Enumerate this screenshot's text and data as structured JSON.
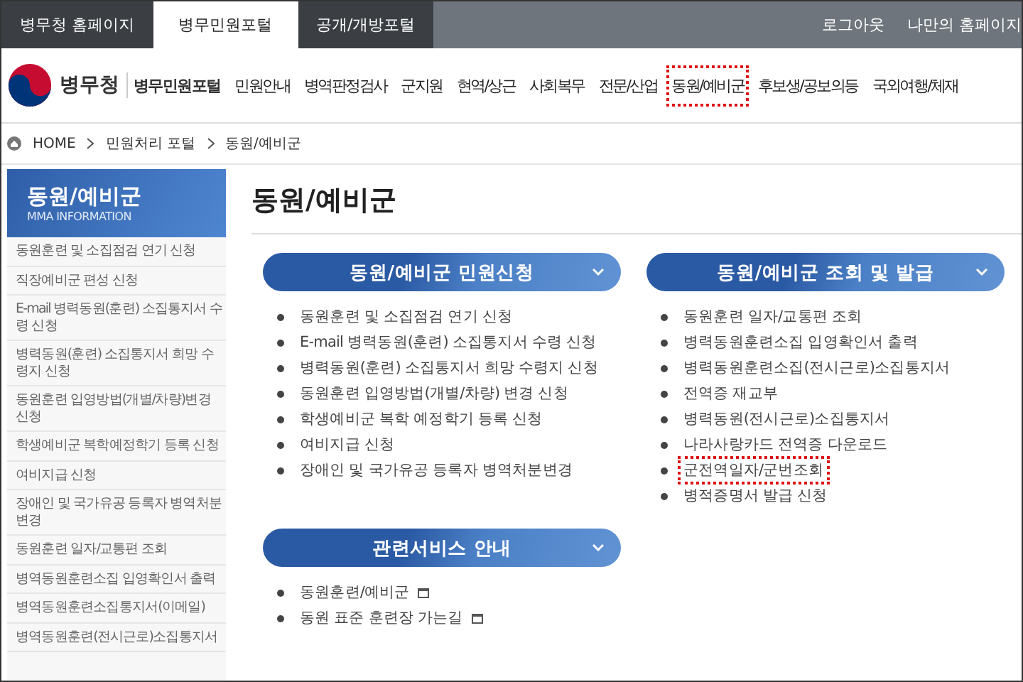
{
  "top_tabs": [
    {
      "label": "병무청 홈페이지",
      "selected": false
    },
    {
      "label": "병무민원포털",
      "selected": true
    },
    {
      "label": "공개/개방포털",
      "selected": false
    }
  ],
  "top_links": [
    "로그아웃",
    "나만의 홈페이지"
  ],
  "logo": {
    "name": "병무청",
    "portal": "병무민원포털"
  },
  "nav": [
    {
      "label": "민원안내",
      "selected": false
    },
    {
      "label": "병역판정검사",
      "selected": false
    },
    {
      "label": "군지원",
      "selected": false
    },
    {
      "label": "현역/상근",
      "selected": false
    },
    {
      "label": "사회복무",
      "selected": false
    },
    {
      "label": "전문/산업",
      "selected": false
    },
    {
      "label": "동원/예비군",
      "selected": true
    },
    {
      "label": "후보생/공보의등",
      "selected": false
    },
    {
      "label": "국외여행/체재",
      "selected": false
    }
  ],
  "breadcrumb": [
    "HOME",
    "민원처리 포털",
    "동원/예비군"
  ],
  "sidebar": {
    "title": "동원/예비군",
    "subtitle": "MMA INFORMATION",
    "items": [
      "동원훈련 및 소집점검 연기 신청",
      "직장예비군 편성 신청",
      "E-mail 병력동원(훈련) 소집통지서 수령 신청",
      "병력동원(훈련) 소집통지서 희망 수령지 신청",
      "동원훈련 입영방법(개별/차량)변경 신청",
      "학생예비군 복학예정학기 등록 신청",
      "여비지급 신청",
      "장애인 및 국가유공 등록자 병역처분변경",
      "동원훈련 일자/교통편 조회",
      "병역동원훈련소집 입영확인서 출력",
      "병역동원훈련소집통지서(이메일)",
      "병역동원훈련(전시근로)소집통지서"
    ]
  },
  "page_title": "동원/예비군",
  "sections": [
    {
      "title": "동원/예비군 민원신청",
      "items": [
        {
          "label": "동원훈련 및 소집점검 연기 신청",
          "highlighted": false
        },
        {
          "label": "E-mail 병력동원(훈련) 소집통지서 수령 신청",
          "highlighted": false
        },
        {
          "label": "병력동원(훈련) 소집통지서 희망 수령지 신청",
          "highlighted": false
        },
        {
          "label": "동원훈련 입영방법(개별/차량) 변경 신청",
          "highlighted": false
        },
        {
          "label": "학생예비군 복학 예정학기 등록 신청",
          "highlighted": false
        },
        {
          "label": "여비지급 신청",
          "highlighted": false
        },
        {
          "label": "장애인 및 국가유공 등록자 병역처분변경",
          "highlighted": false
        }
      ]
    },
    {
      "title": "동원/예비군 조회 및 발급",
      "items": [
        {
          "label": "동원훈련 일자/교통편 조회",
          "highlighted": false
        },
        {
          "label": "병력동원훈련소집 입영확인서 출력",
          "highlighted": false
        },
        {
          "label": "병력동원훈련소집(전시근로)소집통지서",
          "highlighted": false
        },
        {
          "label": "전역증 재교부",
          "highlighted": false
        },
        {
          "label": "병력동원(전시근로)소집통지서",
          "highlighted": false
        },
        {
          "label": "나라사랑카드 전역증 다운로드",
          "highlighted": false
        },
        {
          "label": "군전역일자/군번조회",
          "highlighted": true
        },
        {
          "label": "병적증명서 발급 신청",
          "highlighted": false
        }
      ]
    },
    {
      "title": "관련서비스 안내",
      "items": [
        {
          "label": "동원훈련/예비군",
          "highlighted": false,
          "new_window": true
        },
        {
          "label": "동원 표준 훈련장 가는길",
          "highlighted": false,
          "new_window": true
        }
      ]
    }
  ]
}
